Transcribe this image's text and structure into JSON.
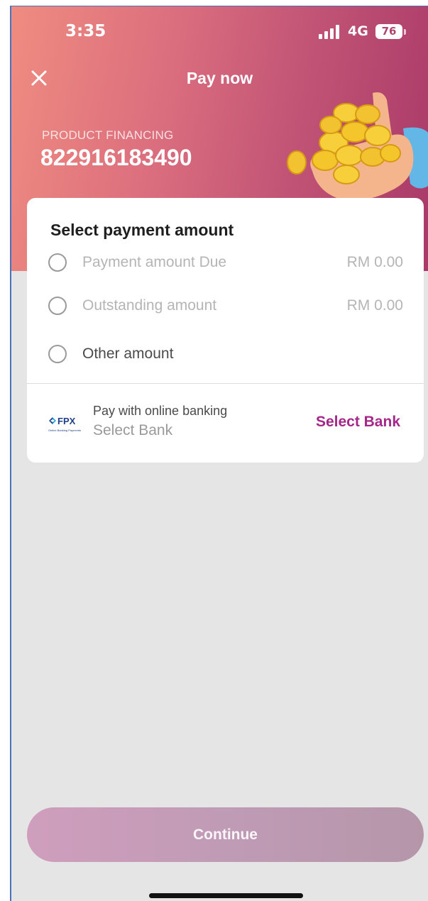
{
  "status_bar": {
    "time": "3:35",
    "network": "4G",
    "battery": "76"
  },
  "header": {
    "title": "Pay now",
    "product_label": "PRODUCT FINANCING",
    "product_number": "822916183490",
    "gradient_colors": [
      "#ef8c80",
      "#a93968"
    ]
  },
  "payment": {
    "title": "Select payment amount",
    "options": [
      {
        "label": "Payment amount Due",
        "amount": "RM 0.00",
        "enabled": false
      },
      {
        "label": "Outstanding amount",
        "amount": "RM 0.00",
        "enabled": false
      },
      {
        "label": "Other amount",
        "amount": "",
        "enabled": true
      }
    ]
  },
  "bank": {
    "logo_text": "FPX",
    "logo_subtext": "Online Banking Payments",
    "label": "Pay with online banking",
    "value": "Select Bank",
    "action": "Select Bank",
    "accent_color": "#a6278a"
  },
  "footer": {
    "continue_label": "Continue"
  },
  "icons": [
    "close-icon",
    "signal-icon",
    "battery-icon",
    "coins-illustration",
    "fpx-logo"
  ]
}
